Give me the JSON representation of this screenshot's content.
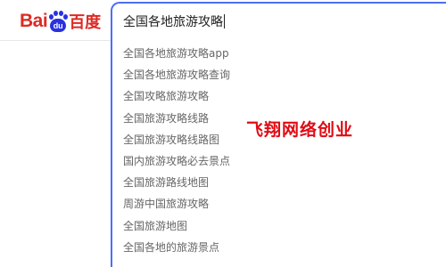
{
  "logo": {
    "left_text": "Bai",
    "paw_text": "du",
    "right_text": "百度"
  },
  "search": {
    "value": "全国各地旅游攻略"
  },
  "suggestions": [
    "全国各地旅游攻略app",
    "全国各地旅游攻略查询",
    "全国攻略旅游攻略",
    "全国旅游攻略线路",
    "全国旅游攻略线路图",
    "国内旅游攻略必去景点",
    "全国旅游路线地图",
    "周游中国旅游攻略",
    "全国旅游地图",
    "全国各地的旅游景点"
  ],
  "watermark": "飞翔网络创业",
  "colors": {
    "brand_red": "#de2a24",
    "brand_blue": "#2932e1",
    "focus_border": "#4e6ef2",
    "suggestion_text": "#666666",
    "watermark": "#e10a14"
  }
}
